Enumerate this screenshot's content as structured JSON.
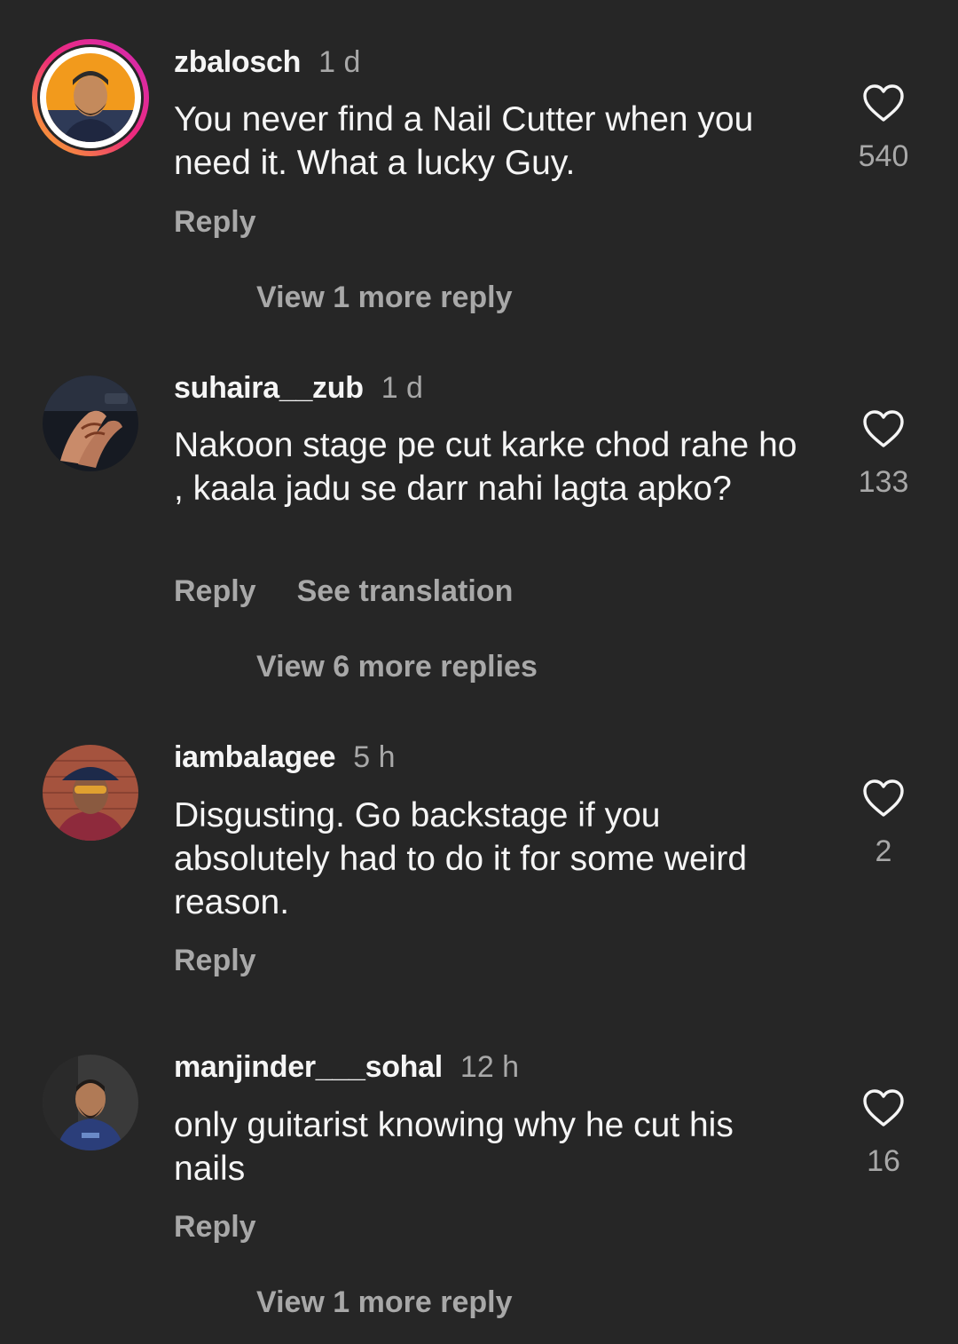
{
  "colors": {
    "background": "#262626",
    "primary_text": "#f5f5f5",
    "secondary_text": "#a8a8a8",
    "story_ring_start": "#f9b027",
    "story_ring_end": "#d22ab3"
  },
  "comments": [
    {
      "username": "zbalosch",
      "time": "1 d",
      "text": "You never find a Nail Cutter when you need it. What a lucky Guy.",
      "reply_label": "Reply",
      "likes": "540",
      "view_replies": "View 1 more reply",
      "icons": {
        "avatar": "profile-avatar-story-ring",
        "like": "heart-outline-icon"
      }
    },
    {
      "username": "suhaira__zub",
      "time": "1 d",
      "text": "Nakoon stage pe cut karke chod rahe ho , kaala jadu se darr nahi lagta apko?",
      "reply_label": "Reply",
      "see_translation": "See translation",
      "likes": "133",
      "view_replies": "View 6 more replies",
      "icons": {
        "avatar": "profile-avatar",
        "like": "heart-outline-icon"
      }
    },
    {
      "username": "iambalagee",
      "time": "5 h",
      "text": "Disgusting. Go backstage if you absolutely had to do it for some weird reason.",
      "reply_label": "Reply",
      "likes": "2",
      "icons": {
        "avatar": "profile-avatar",
        "like": "heart-outline-icon"
      }
    },
    {
      "username": "manjinder___sohal",
      "time": "12 h",
      "text": "only guitarist knowing why he cut his nails",
      "reply_label": "Reply",
      "likes": "16",
      "view_replies": "View 1 more reply",
      "icons": {
        "avatar": "profile-avatar",
        "like": "heart-outline-icon"
      }
    }
  ]
}
